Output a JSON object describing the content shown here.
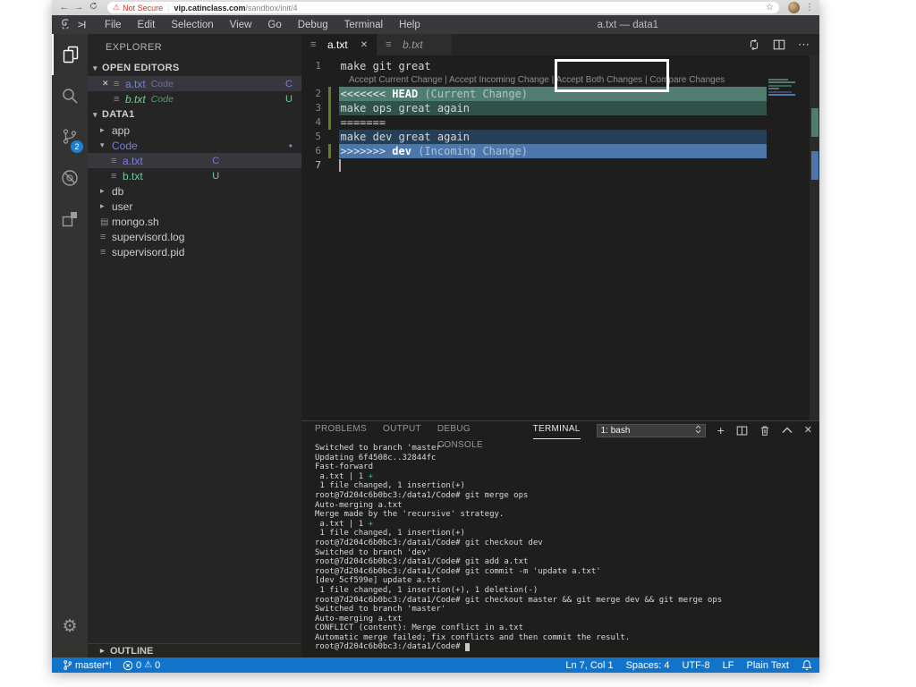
{
  "browser": {
    "back": "←",
    "forward": "→",
    "security_warning": "Not Secure",
    "url_domain": "vip.catinclass.com",
    "url_path": "/sandbox/init/4"
  },
  "titlebar": {
    "menus": [
      "File",
      "Edit",
      "Selection",
      "View",
      "Go",
      "Debug",
      "Terminal",
      "Help"
    ],
    "title": "a.txt — data1"
  },
  "activitybar": {
    "scm_badge": "2"
  },
  "sidebar": {
    "title": "EXPLORER",
    "open_editors_header": "OPEN EDITORS",
    "open_editors": [
      {
        "closable": true,
        "icon": "icon-file",
        "label": "a.txt",
        "desc": "Code",
        "lcls": "c-conflict",
        "dcls": "d-conflict",
        "badge": "C",
        "bcls": "c-conflict",
        "rowcls": "active"
      },
      {
        "closable": false,
        "icon": "icon-file",
        "label": "b.txt",
        "desc": "Code",
        "lcls": "c-green italic",
        "dcls": "d-green italic",
        "badge": "U",
        "bcls": "c-green",
        "rowcls": ""
      }
    ],
    "tree_header": "DATA1",
    "tree": [
      {
        "chevron": "chev-right",
        "icon": "icon-none",
        "label": "app",
        "lcls": "",
        "cls": "ind0",
        "badge": "",
        "bcls": "",
        "dot": false
      },
      {
        "chevron": "chev-down",
        "icon": "icon-none",
        "label": "Code",
        "lcls": "c-conflict",
        "cls": "ind0",
        "badge": "",
        "bcls": "",
        "dot": true
      },
      {
        "chevron": "chev-none",
        "icon": "icon-file",
        "label": "a.txt",
        "lcls": "c-conflict",
        "cls": "ind1 selected",
        "badge": "C",
        "bcls": "c-conflict",
        "dot": false
      },
      {
        "chevron": "chev-none",
        "icon": "icon-file",
        "label": "b.txt",
        "lcls": "c-green",
        "cls": "ind1",
        "badge": "U",
        "bcls": "c-green",
        "dot": false
      },
      {
        "chevron": "chev-right",
        "icon": "icon-none",
        "label": "db",
        "lcls": "",
        "cls": "ind0",
        "badge": "",
        "bcls": "",
        "dot": false
      },
      {
        "chevron": "chev-right",
        "icon": "icon-none",
        "label": "user",
        "lcls": "",
        "cls": "ind0",
        "badge": "",
        "bcls": "",
        "dot": false
      },
      {
        "chevron": "chev-none",
        "icon": "icon-shell",
        "label": "mongo.sh",
        "lcls": "",
        "cls": "ind0f",
        "badge": "",
        "bcls": "",
        "dot": false
      },
      {
        "chevron": "chev-none",
        "icon": "icon-file",
        "label": "supervisord.log",
        "lcls": "",
        "cls": "ind0f",
        "badge": "",
        "bcls": "",
        "dot": false
      },
      {
        "chevron": "chev-none",
        "icon": "icon-file",
        "label": "supervisord.pid",
        "lcls": "",
        "cls": "ind0f",
        "badge": "",
        "bcls": "",
        "dot": false
      }
    ],
    "outline_header": "OUTLINE"
  },
  "editor": {
    "tabs": [
      {
        "label": "a.txt",
        "cls": "active",
        "closable": true
      },
      {
        "label": "b.txt",
        "cls": "inactive",
        "closable": false
      }
    ],
    "first_line": [
      {
        "n": "1",
        "text": "make git great",
        "cls": "",
        "ncls": "",
        "gutter": false,
        "cursor": false
      }
    ],
    "codelens": "Accept Current Change | Accept Incoming Change | Accept Both Changes | Compare Changes",
    "conflict_lines": [
      {
        "n": "2",
        "cls": "hl-ch",
        "ncls": "",
        "gutter": true,
        "cursor": false,
        "parts": [
          {
            "t": "<<<<<<< ",
            "c": "p-soft"
          },
          {
            "t": "HEAD",
            "c": "p-bold"
          },
          {
            "t": " (Current Change)",
            "c": "p-faint"
          }
        ]
      },
      {
        "n": "3",
        "text": "make ops great again",
        "cls": "hl-cc",
        "ncls": "",
        "gutter": true,
        "cursor": false
      },
      {
        "n": "4",
        "text": "=======",
        "cls": "",
        "ncls": "",
        "gutter": true,
        "cursor": false
      },
      {
        "n": "5",
        "text": "make dev great again",
        "cls": "hl-ic",
        "ncls": "",
        "gutter": false,
        "cursor": false
      },
      {
        "n": "6",
        "cls": "hl-ih",
        "ncls": "",
        "gutter": true,
        "cursor": false,
        "parts": [
          {
            "t": ">>>>>>> ",
            "c": "p-soft"
          },
          {
            "t": "dev",
            "c": "p-bold"
          },
          {
            "t": " (Incoming Change)",
            "c": "p-faint"
          }
        ]
      },
      {
        "n": "7",
        "text": "",
        "cls": "",
        "ncls": "active-ln",
        "gutter": false,
        "cursor": true
      }
    ]
  },
  "panel": {
    "tabs": [
      {
        "label": "PROBLEMS",
        "cls": ""
      },
      {
        "label": "OUTPUT",
        "cls": ""
      },
      {
        "label": "DEBUG CONSOLE",
        "cls": ""
      },
      {
        "label": "TERMINAL",
        "cls": "active"
      }
    ],
    "terminal_select": "1: bash",
    "terminal_lines": [
      {
        "text": "Switched to branch 'master'"
      },
      {
        "text": "Updating 6f4508c..32844fc"
      },
      {
        "text": "Fast-forward"
      },
      {
        "parts": [
          {
            "t": " a.txt | 1 "
          },
          {
            "t": "+",
            "c": "term-green"
          }
        ]
      },
      {
        "text": " 1 file changed, 1 insertion(+)"
      },
      {
        "text": "root@7d204c6b0bc3:/data1/Code# git merge ops"
      },
      {
        "text": "Auto-merging a.txt"
      },
      {
        "text": "Merge made by the 'recursive' strategy."
      },
      {
        "parts": [
          {
            "t": " a.txt | 1 "
          },
          {
            "t": "+",
            "c": "term-green"
          }
        ]
      },
      {
        "text": " 1 file changed, 1 insertion(+)"
      },
      {
        "text": "root@7d204c6b0bc3:/data1/Code# git checkout dev"
      },
      {
        "text": "Switched to branch 'dev'"
      },
      {
        "text": "root@7d204c6b0bc3:/data1/Code# git add a.txt"
      },
      {
        "text": "root@7d204c6b0bc3:/data1/Code# git commit -m 'update a.txt'"
      },
      {
        "text": "[dev 5cf599e] update a.txt"
      },
      {
        "text": " 1 file changed, 1 insertion(+), 1 deletion(-)"
      },
      {
        "text": "root@7d204c6b0bc3:/data1/Code# git checkout master && git merge dev && git merge ops"
      },
      {
        "text": "Switched to branch 'master'"
      },
      {
        "text": "Auto-merging a.txt"
      },
      {
        "text": "CONFLICT (content): Merge conflict in a.txt"
      },
      {
        "text": "Automatic merge failed; fix conflicts and then commit the result."
      },
      {
        "parts": [
          {
            "t": "root@7d204c6b0bc3:/data1/Code# "
          },
          {
            "t": " ",
            "c": "term-cursor"
          }
        ]
      }
    ]
  },
  "statusbar": {
    "branch": "master*!",
    "errors": "0",
    "warnings": "0",
    "cursor": "Ln 7, Col 1",
    "indent": "Spaces: 4",
    "encoding": "UTF-8",
    "eol": "LF",
    "language": "Plain Text"
  },
  "colors": {
    "statusbar_blue": "#1173c9",
    "scm_badge_blue": "#1c81d6",
    "conflict_purple": "#7781d6",
    "git_green": "#73c991",
    "merge_current_header": "#4f7e70",
    "merge_current_content": "#2f5348",
    "merge_incoming_content": "#263f58",
    "merge_incoming_header": "#4b77ab",
    "gutter_modified_green": "#64801e",
    "annotation_border": "#ffffff"
  }
}
